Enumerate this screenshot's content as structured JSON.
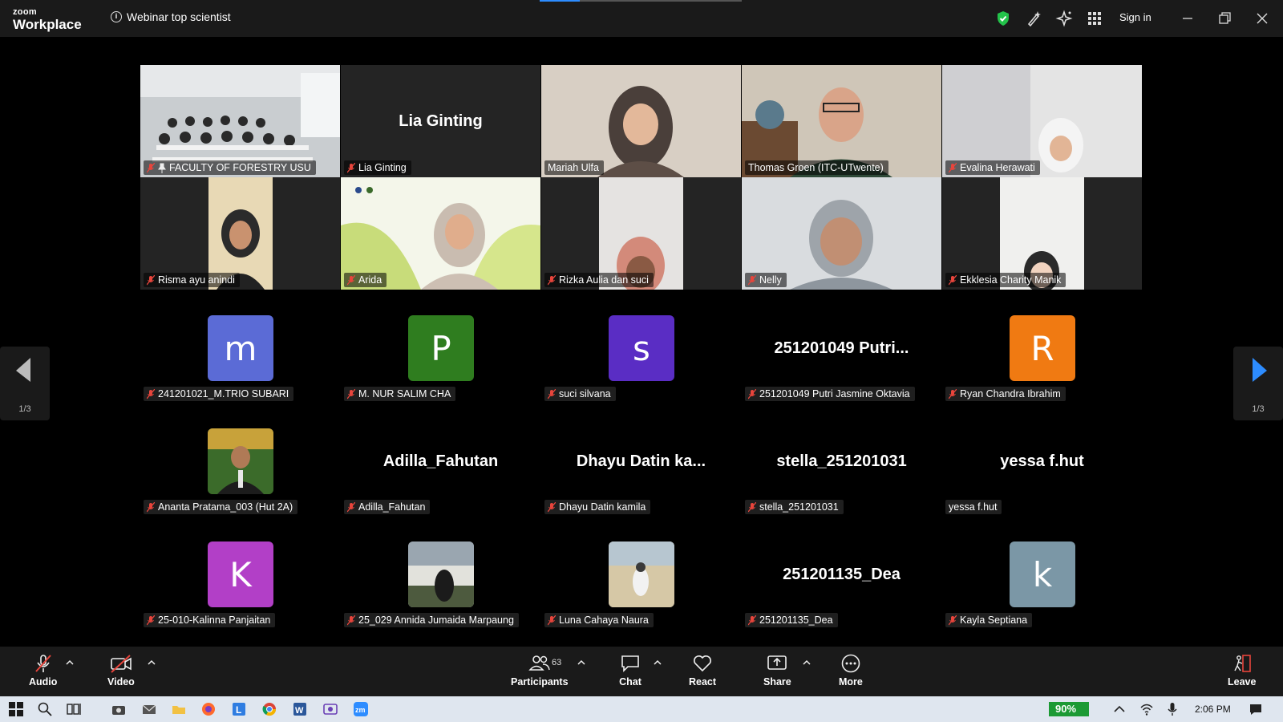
{
  "app": {
    "logo_line1": "zoom",
    "logo_line2": "Workplace",
    "meeting_title": "Webinar top  scientist",
    "sign_in": "Sign in"
  },
  "video_tiles": [
    {
      "name": "FACULTY OF FORESTRY USU",
      "pinned": true
    },
    {
      "name": "Lia Ginting",
      "display": "Lia Ginting"
    },
    {
      "name": "Mariah Ulfa",
      "speaking": true
    },
    {
      "name": "Thomas Groen (ITC-UTwente)"
    },
    {
      "name": "Evalina Herawati"
    },
    {
      "name": "Risma ayu anindi"
    },
    {
      "name": "Arida"
    },
    {
      "name": "Rizka Aulia dan suci"
    },
    {
      "name": "Nelly"
    },
    {
      "name": "Ekklesia Charity Manik"
    }
  ],
  "participants_grid": [
    {
      "name": "241201021_M.TRIO SUBARI",
      "avatar": "m",
      "color": "#5b6bd6"
    },
    {
      "name": "M. NUR SALIM CHA",
      "avatar": "P",
      "color": "#2f7d1f"
    },
    {
      "name": "suci silvana",
      "avatar": "s",
      "color": "#5a2dc4"
    },
    {
      "name": "251201049 Putri Jasmine Oktavia",
      "display": "251201049  Putri..."
    },
    {
      "name": "Ryan Chandra Ibrahim",
      "avatar": "R",
      "color": "#f07a12"
    },
    {
      "name": "Ananta Pratama_003 (Hut 2A)",
      "photo": true
    },
    {
      "name": "Adilla_Fahutan",
      "display": "Adilla_Fahutan"
    },
    {
      "name": "Dhayu Datin kamila",
      "display": "Dhayu Datin ka..."
    },
    {
      "name": "stella_251201031",
      "display": "stella_251201031"
    },
    {
      "name": "yessa f.hut",
      "display": "yessa f.hut",
      "unmuted": true
    },
    {
      "name": "25-010-Kalinna Panjaitan",
      "avatar": "K",
      "color": "#b23fc7"
    },
    {
      "name": "25_029 Annida Jumaida Marpaung",
      "photo": true
    },
    {
      "name": "Luna Cahaya Naura",
      "photo": true
    },
    {
      "name": "251201135_Dea",
      "display": "251201135_Dea"
    },
    {
      "name": "Kayla Septiana",
      "avatar": "k",
      "color": "#7b97a6"
    }
  ],
  "pagination": {
    "left": "1/3",
    "right": "1/3"
  },
  "toolbar": {
    "audio": "Audio",
    "video": "Video",
    "participants": "Participants",
    "participant_count": "63",
    "chat": "Chat",
    "react": "React",
    "share": "Share",
    "more": "More",
    "leave": "Leave"
  },
  "taskbar": {
    "battery": "90%",
    "time": "2:06 PM"
  },
  "colors": {
    "speaking_border": "#23d959",
    "mute_red": "#e8453c",
    "accent": "#2d8cff"
  }
}
